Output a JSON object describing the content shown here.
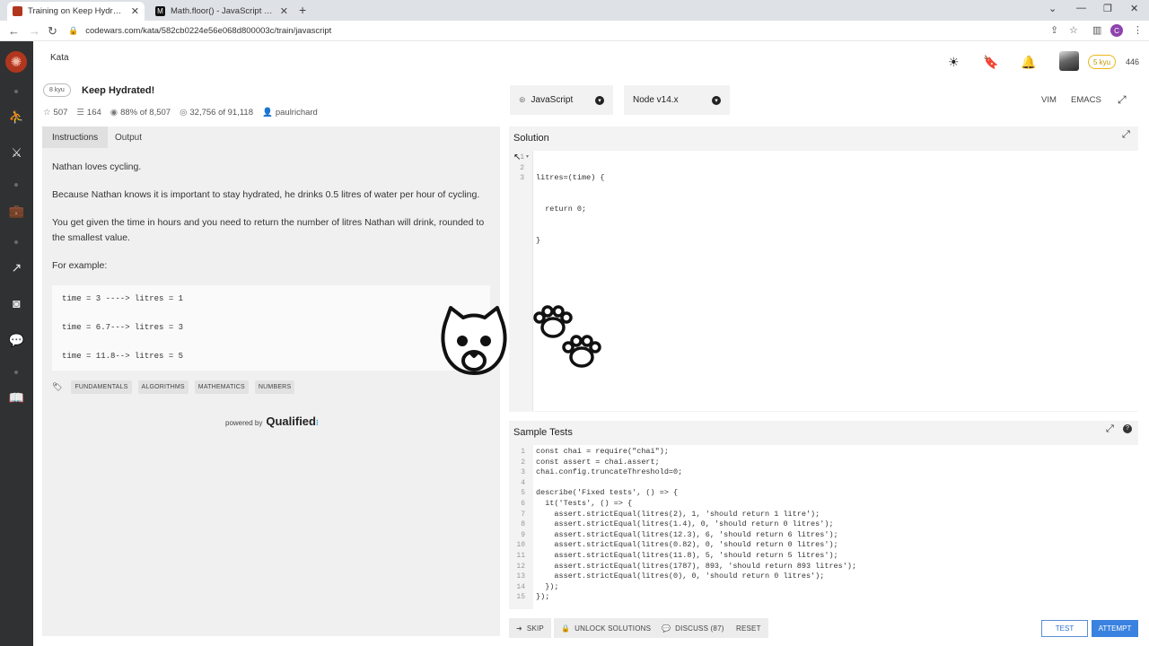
{
  "browser": {
    "tabs": [
      {
        "title": "Training on Keep Hydrated! | Co",
        "favicon_color": "#b1361e",
        "active": true
      },
      {
        "title": "Math.floor() - JavaScript | MDN",
        "favicon_color": "#000000",
        "active": false
      }
    ],
    "new_tab_icon": "plus-icon",
    "url": "codewars.com/kata/582cb0224e56e068d800003c/train/javascript",
    "profile_initial": "C",
    "profile_color": "#8e44ad"
  },
  "header": {
    "kata_link": "Kata",
    "rank_badge": "5 kyu",
    "honor": "446",
    "icons": [
      "theme-sun-icon",
      "bookmark-icon",
      "notification-bell-icon"
    ]
  },
  "kata": {
    "kyu": "8 kyu",
    "title": "Keep Hydrated!",
    "stats": {
      "stars": "507",
      "collections": "164",
      "satisfaction": "88% of 8,507",
      "completed": "32,756 of 91,118",
      "author": "paulrichard"
    }
  },
  "left_tabs": {
    "instructions": "Instructions",
    "output": "Output"
  },
  "description": {
    "p1": "Nathan loves cycling.",
    "p2": "Because Nathan knows it is important to stay hydrated, he drinks 0.5 litres of water per hour of cycling.",
    "p3": "You get given the time in hours and you need to return the number of litres Nathan will drink, rounded to the smallest value.",
    "p4": "For example:",
    "examples": [
      "time = 3 ----> litres = 1",
      "time = 6.7---> litres = 3",
      "time = 11.8--> litres = 5"
    ]
  },
  "tags": [
    "FUNDAMENTALS",
    "ALGORITHMS",
    "MATHEMATICS",
    "NUMBERS"
  ],
  "powered_by": {
    "prefix": "powered by",
    "brand": "Qualified"
  },
  "selectors": {
    "language": "JavaScript",
    "runtime": "Node v14.x"
  },
  "editor_modes": {
    "vim": "VIM",
    "emacs": "EMACS"
  },
  "solution": {
    "title": "Solution",
    "lines": [
      "litres=(time) {",
      "  return 0;",
      "}"
    ],
    "line_numbers": [
      "1",
      "2",
      "3"
    ]
  },
  "sample_tests": {
    "title": "Sample Tests",
    "lines": [
      "const chai = require(\"chai\");",
      "const assert = chai.assert;",
      "chai.config.truncateThreshold=0;",
      "",
      "describe('Fixed tests', () => {",
      "  it('Tests', () => {",
      "    assert.strictEqual(litres(2), 1, 'should return 1 litre');",
      "    assert.strictEqual(litres(1.4), 0, 'should return 0 litres');",
      "    assert.strictEqual(litres(12.3), 6, 'should return 6 litres');",
      "    assert.strictEqual(litres(0.82), 0, 'should return 0 litres');",
      "    assert.strictEqual(litres(11.8), 5, 'should return 5 litres');",
      "    assert.strictEqual(litres(1787), 893, 'should return 893 litres');",
      "    assert.strictEqual(litres(0), 0, 'should return 0 litres');",
      "  });",
      "});"
    ],
    "line_numbers": [
      "1",
      "2",
      "3",
      "4",
      "5",
      "6",
      "7",
      "8",
      "9",
      "10",
      "11",
      "12",
      "13",
      "14",
      "15"
    ]
  },
  "footer": {
    "skip": "SKIP",
    "unlock": "UNLOCK SOLUTIONS",
    "discuss": "DISCUSS (87)",
    "reset": "RESET",
    "test": "TEST",
    "attempt": "ATTEMPT"
  },
  "colors": {
    "accent": "#3a82e0",
    "brand": "#b1361e",
    "rank": "#ecb613"
  }
}
